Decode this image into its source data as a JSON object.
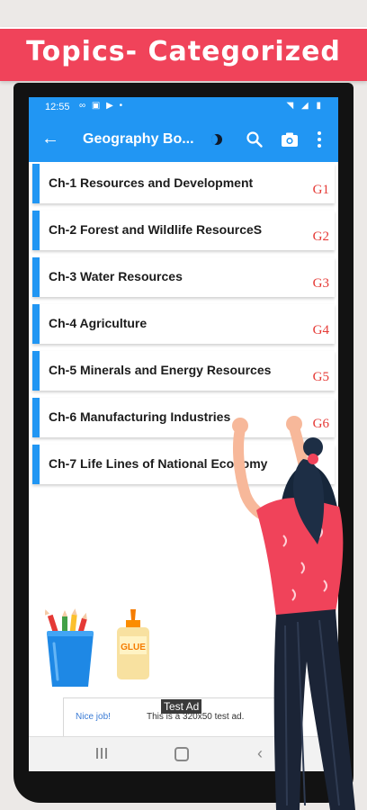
{
  "banner": {
    "text": "Topics- Categorized"
  },
  "status_bar": {
    "time": "12:55"
  },
  "app_bar": {
    "title": "Geography Bo..."
  },
  "icons": {
    "back": "arrow-left-icon",
    "theme": "moon-icon",
    "search": "search-icon",
    "camera": "camera-icon",
    "more": "more-vert-icon"
  },
  "chapters": [
    {
      "label": "Ch-1 Resources and Development",
      "code": "G1"
    },
    {
      "label": "Ch-2 Forest and Wildlife ResourceS",
      "code": "G2"
    },
    {
      "label": "Ch-3 Water Resources",
      "code": "G3"
    },
    {
      "label": "Ch-4 Agriculture",
      "code": "G4"
    },
    {
      "label": "Ch-5 Minerals and Energy Resources",
      "code": "G5"
    },
    {
      "label": "Ch-6 Manufacturing Industries",
      "code": "G6"
    },
    {
      "label": "Ch-7 Life Lines of National Economy",
      "code": ""
    }
  ],
  "glue_label": "GLUE",
  "ad": {
    "tag": "Test Ad",
    "cta": "Nice job!",
    "text": "This is a 320x50 test ad."
  },
  "colors": {
    "banner": "#f0435a",
    "primary": "#2196f3",
    "code": "#e53935"
  }
}
